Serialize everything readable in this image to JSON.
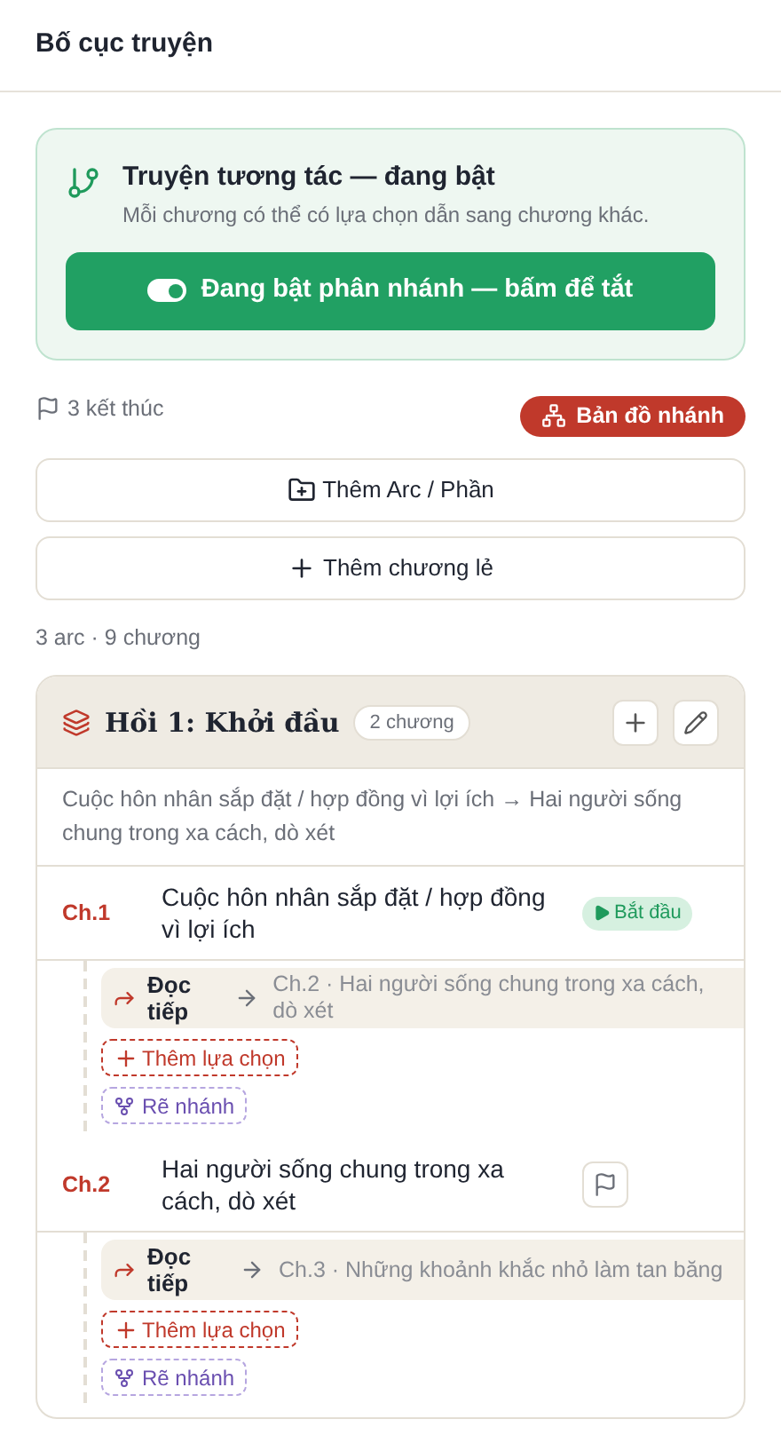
{
  "header": {
    "title": "Bố cục truyện"
  },
  "interactive": {
    "title": "Truyện tương tác — đang bật",
    "description": "Mỗi chương có thể có lựa chọn dẫn sang chương khác.",
    "toggle_label": "Đang bật phân nhánh — bấm để tắt",
    "on": true
  },
  "endings": "3 kết thúc",
  "map_button": "Bản đồ nhánh",
  "add_arc": "Thêm Arc / Phần",
  "add_chapter": "Thêm chương lẻ",
  "summary": "3 arc · 9 chương",
  "arc": {
    "title": "Hồi 1: Khởi đầu",
    "count": "2 chương",
    "description": "Cuộc hôn nhân sắp đặt / hợp đồng vì lợi ích → Hai người sống chung trong xa cách, dò xét",
    "chapters": [
      {
        "number": "Ch.1",
        "title": "Cuộc hôn nhân sắp đặt / hợp đồng vì lợi ích",
        "badge": "Bắt đầu",
        "choice_label": "Đọc tiếp",
        "target": "Ch.2 · Hai người sống chung trong xa cách, dò xét",
        "add_choice": "Thêm lựa chọn",
        "branch": "Rẽ nhánh"
      },
      {
        "number": "Ch.2",
        "title": "Hai người sống chung trong xa cách, dò xét",
        "choice_label": "Đọc tiếp",
        "target": "Ch.3 · Những khoảnh khắc nhỏ làm tan băng",
        "add_choice": "Thêm lựa chọn",
        "branch": "Rẽ nhánh"
      }
    ]
  }
}
